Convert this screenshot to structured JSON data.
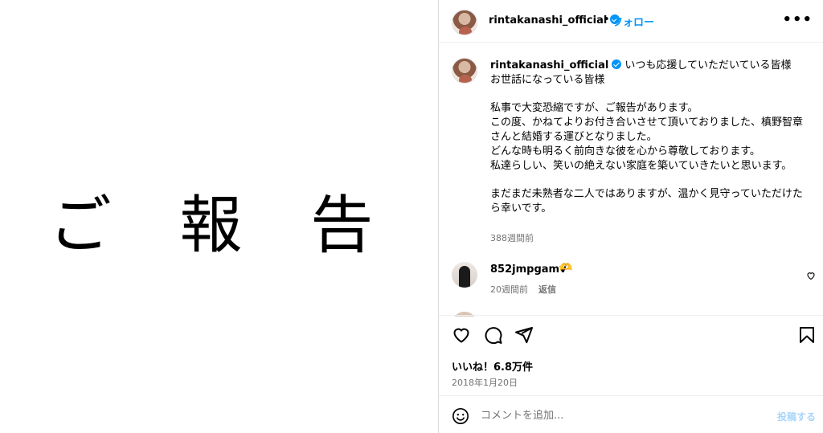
{
  "media": {
    "text": "ご 報 告"
  },
  "header": {
    "username": "rintakanashi_official",
    "separator": "•",
    "follow_label": "フォロー",
    "more_label": "•••"
  },
  "caption": {
    "username": "rintakanashi_official",
    "text": "いつも応援していただいている皆様\nお世話になっている皆様\n\n私事で大変恐縮ですが、ご報告があります。\nこの度、かねてよりお付き合いさせて頂いておりました、槙野智章さんと結婚する運びとなりました。\nどんな時も明るく前向きな彼を心から尊敬しております。\n私達らしい、笑いの絶えない家庭を築いていきたいと思います。\n\nまだまだ未熟者な二人ではありますが、温かく見守っていただけたら幸いです。",
    "time": "388週間前"
  },
  "comment": {
    "username": "852jmpgamv",
    "emoji": "🫶",
    "time": "20週間前",
    "reply_label": "返信"
  },
  "actions": {
    "likes": "いいね！6.8万件",
    "date": "2018年1月20日"
  },
  "comment_box": {
    "placeholder": "コメントを追加...",
    "post_label": "投稿する"
  },
  "colors": {
    "accent": "#0095f6",
    "muted": "#737373",
    "post_disabled": "#a8d6fb"
  }
}
